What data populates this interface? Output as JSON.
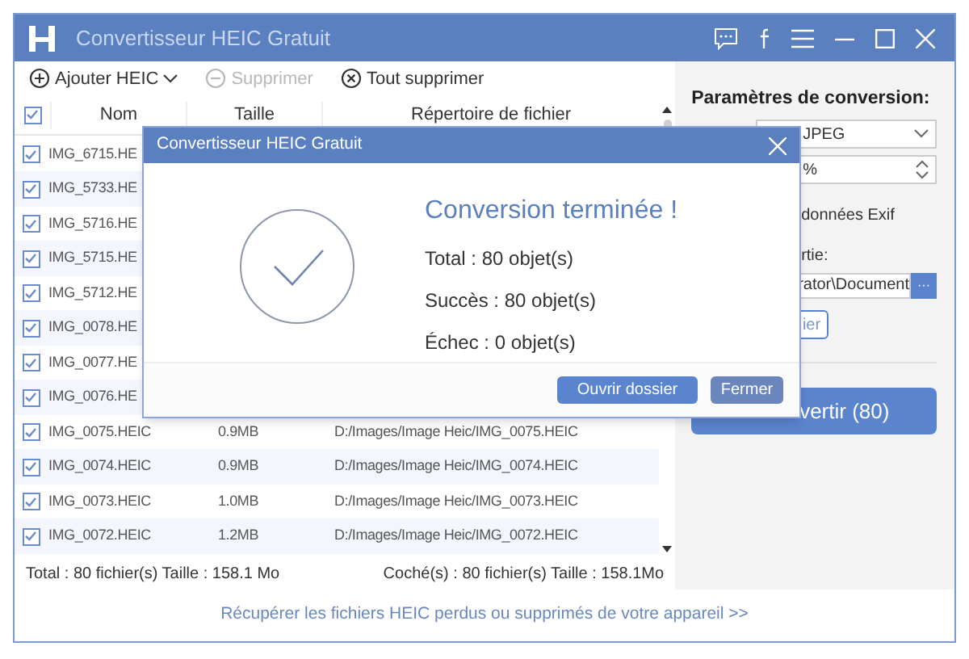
{
  "window": {
    "title": "Convertisseur HEIC Gratuit"
  },
  "toolbar": [
    {
      "kind": "add",
      "label": "Ajouter HEIC",
      "disabled": false
    },
    {
      "kind": "remove",
      "label": "Supprimer",
      "disabled": true
    },
    {
      "kind": "clear",
      "label": "Tout supprimer",
      "disabled": false
    }
  ],
  "table": {
    "header_checked": true,
    "columns": [
      "Nom",
      "Taille",
      "Répertoire de fichier"
    ],
    "rows": [
      {
        "checked": true,
        "name": "IMG_6715.HE"
      },
      {
        "checked": true,
        "name": "IMG_5733.HE"
      },
      {
        "checked": true,
        "name": "IMG_5716.HE"
      },
      {
        "checked": true,
        "name": "IMG_5715.HE"
      },
      {
        "checked": true,
        "name": "IMG_5712.HE"
      },
      {
        "checked": true,
        "name": "IMG_0078.HE"
      },
      {
        "checked": true,
        "name": "IMG_0077.HE"
      },
      {
        "checked": true,
        "name": "IMG_0076.HE"
      },
      {
        "checked": true,
        "name": "IMG_0075.HEIC",
        "size": "0.9MB",
        "path": "D:/Images/Image Heic/IMG_0075.HEIC"
      },
      {
        "checked": true,
        "name": "IMG_0074.HEIC",
        "size": "0.9MB",
        "path": "D:/Images/Image Heic/IMG_0074.HEIC"
      },
      {
        "checked": true,
        "name": "IMG_0073.HEIC",
        "size": "1.0MB",
        "path": "D:/Images/Image Heic/IMG_0073.HEIC"
      },
      {
        "checked": true,
        "name": "IMG_0072.HEIC",
        "size": "1.2MB",
        "path": "D:/Images/Image Heic/IMG_0072.HEIC"
      }
    ]
  },
  "status": {
    "total": "Total : 80 fichier(s) Taille : 158.1 Mo",
    "checked": "Coché(s) : 80 fichier(s) Taille : 158.1Mo"
  },
  "settings": {
    "title": "Paramètres de conversion:",
    "format": "JPEG",
    "quality": "%",
    "exif_label": "données Exif",
    "output_label": "rtie:",
    "output_path": "rator\\Document",
    "browse": "···",
    "open_button": "ier",
    "convert_button": "vertir (80)"
  },
  "link": "Récupérer les fichiers HEIC perdus ou supprimés de votre appareil >>",
  "dialog": {
    "title": "Convertisseur HEIC Gratuit",
    "heading": "Conversion terminée !",
    "lines": [
      "Total : 80 objet(s)",
      "Succès : 80 objet(s)",
      "Échec : 0 objet(s)"
    ],
    "buttons": [
      "Ouvrir dossier",
      "Fermer"
    ]
  }
}
